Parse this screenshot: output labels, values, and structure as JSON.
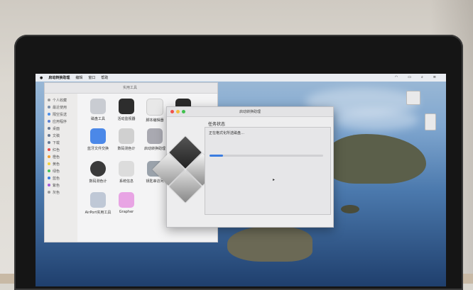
{
  "menubar": {
    "app_name": "启动转换助理",
    "items": [
      "编辑",
      "窗口",
      "帮助"
    ]
  },
  "finder": {
    "title": "实用工具",
    "sidebar_items": [
      {
        "label": "个人收藏",
        "color": "#9a9a9a"
      },
      {
        "label": "最近使用",
        "color": "#7c8fa8"
      },
      {
        "label": "隔空投送",
        "color": "#4a8ee8"
      },
      {
        "label": "应用程序",
        "color": "#5b7fd1"
      },
      {
        "label": "桌面",
        "color": "#6b7a92"
      },
      {
        "label": "文稿",
        "color": "#6b7a92"
      },
      {
        "label": "下载",
        "color": "#6b7a92"
      },
      {
        "label": "红色",
        "color": "#e34b4b"
      },
      {
        "label": "橙色",
        "color": "#f0a032"
      },
      {
        "label": "黄色",
        "color": "#f1d23a"
      },
      {
        "label": "绿色",
        "color": "#43c25b"
      },
      {
        "label": "蓝色",
        "color": "#3b7de0"
      },
      {
        "label": "紫色",
        "color": "#a45ad8"
      },
      {
        "label": "灰色",
        "color": "#9a9a9a"
      }
    ],
    "apps": [
      {
        "label": "磁盘工具",
        "color": "#c9ccd2"
      },
      {
        "label": "活动监视器",
        "color": "#2d2d2d"
      },
      {
        "label": "脚本编辑器",
        "color": "#e8e8e8"
      },
      {
        "label": "",
        "color": "#2a2a2a"
      },
      {
        "label": "蓝牙文件交换",
        "color": "#4b88e8"
      },
      {
        "label": "数码测色计",
        "color": "#d0d0d0"
      },
      {
        "label": "启动转换助理",
        "color": "#a9a9b1"
      },
      {
        "label": "",
        "color": "#f0f0f0"
      },
      {
        "label": "数码测色计",
        "color": "#3a3a3a"
      },
      {
        "label": "系统信息",
        "color": "#dcdcdc"
      },
      {
        "label": "钥匙串访问",
        "color": "#9aa2ab"
      },
      {
        "label": "",
        "color": "#f0f0f0"
      },
      {
        "label": "AirPort实用工具",
        "color": "#bfc8d6"
      },
      {
        "label": "Grapher",
        "color": "#e8a4e4"
      }
    ]
  },
  "dialog": {
    "title": "启动转换助理",
    "heading": "任务状态",
    "status_text": "正在格式化所选磁盘…",
    "progress": 0.12
  },
  "colors": {
    "accent": "#3b7de0",
    "traffic_red": "#f0524a",
    "traffic_yellow": "#f4bd3b",
    "traffic_green": "#3fc14d"
  }
}
